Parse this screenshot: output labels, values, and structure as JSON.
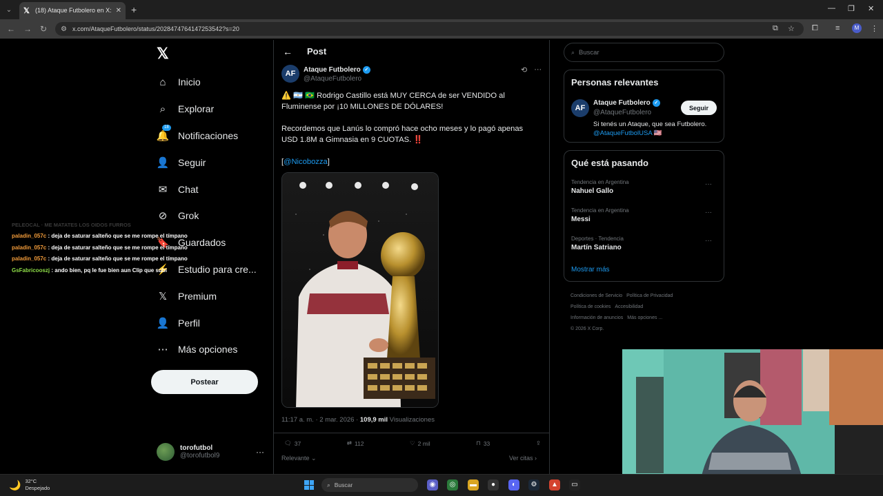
{
  "browser": {
    "tab_title": "(18) Ataque Futbolero en X: \"⚠",
    "url": "x.com/AtaqueFutbolero/status/2028474764147253542?s=20",
    "profile_initial": "M"
  },
  "sidebar": {
    "items": [
      {
        "label": "Inicio",
        "icon": "home-icon"
      },
      {
        "label": "Explorar",
        "icon": "search-icon"
      },
      {
        "label": "Notificaciones",
        "icon": "bell-icon",
        "badge": "18"
      },
      {
        "label": "Seguir",
        "icon": "person-plus-icon"
      },
      {
        "label": "Chat",
        "icon": "mail-icon"
      },
      {
        "label": "Grok",
        "icon": "grok-icon"
      },
      {
        "label": "Guardados",
        "icon": "bookmark-icon"
      },
      {
        "label": "Estudio para cre...",
        "icon": "creator-studio-icon"
      },
      {
        "label": "Premium",
        "icon": "x-logo-icon"
      },
      {
        "label": "Perfil",
        "icon": "person-icon"
      },
      {
        "label": "Más opciones",
        "icon": "more-circle-icon"
      }
    ],
    "post_button": "Postear",
    "account": {
      "name": "torofutbol",
      "handle": "@torofutbol9"
    }
  },
  "chat_overlay": {
    "header": "PELEOCAL · ME MATATES LOS OIDOS FURROS",
    "lines": [
      {
        "user": "paladin_057c",
        "text": ": deja de saturar salteño que se me rompe el tímpano"
      },
      {
        "user": "paladin_057c",
        "text": ": deja de saturar salteño que se me rompe el tímpano"
      },
      {
        "user": "paladin_057c",
        "text": ": deja de saturar salteño que se me rompe el tímpano"
      },
      {
        "user": "GsFabricooszj",
        "text": ": ando bien, pq le fue bien aun Clip que subi"
      }
    ]
  },
  "post": {
    "header": "Post",
    "author": "Ataque Futbolero",
    "handle": "@AtaqueFutbolero",
    "avatar_text": "AF",
    "paragraph1": "⚠️ 🇦🇷 🇧🇷 Rodrigo Castillo está MUY CERCA de ser VENDIDO al Fluminense por ¡10 MILLONES DE DÓLARES!",
    "paragraph2": "Recordemos que Lanús lo compró hace ocho meses y lo pagó apenas USD 1.8M a Gimnasia en 9 CUOTAS. ‼️",
    "mention_open": "[",
    "mention": "@Nicobozza",
    "mention_close": "]",
    "time": "11:17 a. m. · 2 mar. 2026 · ",
    "views_count": "109,9 mil",
    "views_label": " Visualizaciones",
    "replies": "37",
    "reposts": "112",
    "likes": "2 mil",
    "bookmarks": "33",
    "sort_label": "Relevante",
    "quotes_label": "Ver citas"
  },
  "right": {
    "search_placeholder": "Buscar",
    "relevant_title": "Personas relevantes",
    "relevant": {
      "name": "Ataque Futbolero",
      "handle": "@AtaqueFutbolero",
      "follow": "Seguir",
      "bio": "Si tenés un Ataque, que sea Futbolero.",
      "bio_link": "@AtaqueFutbolUSA",
      "bio_flag": "🇺🇸"
    },
    "trends_title": "Qué está pasando",
    "trends": [
      {
        "context": "Tendencia en Argentina",
        "name": "Nahuel Gallo"
      },
      {
        "context": "Tendencia en Argentina",
        "name": "Messi"
      },
      {
        "context": "Deportes · Tendencia",
        "name": "Martín Satriano"
      }
    ],
    "show_more": "Mostrar más",
    "footer": [
      "Condiciones de Servicio",
      "Política de Privacidad",
      "Política de cookies",
      "Accesibilidad",
      "Información de anuncios",
      "Más opciones ...",
      "© 2026 X Corp."
    ]
  },
  "taskbar": {
    "temperature": "32°C",
    "weather": "Despejado",
    "search": "Buscar"
  },
  "colors": {
    "accent": "#1d9bf0",
    "background": "#000000",
    "border": "#2f3336"
  }
}
